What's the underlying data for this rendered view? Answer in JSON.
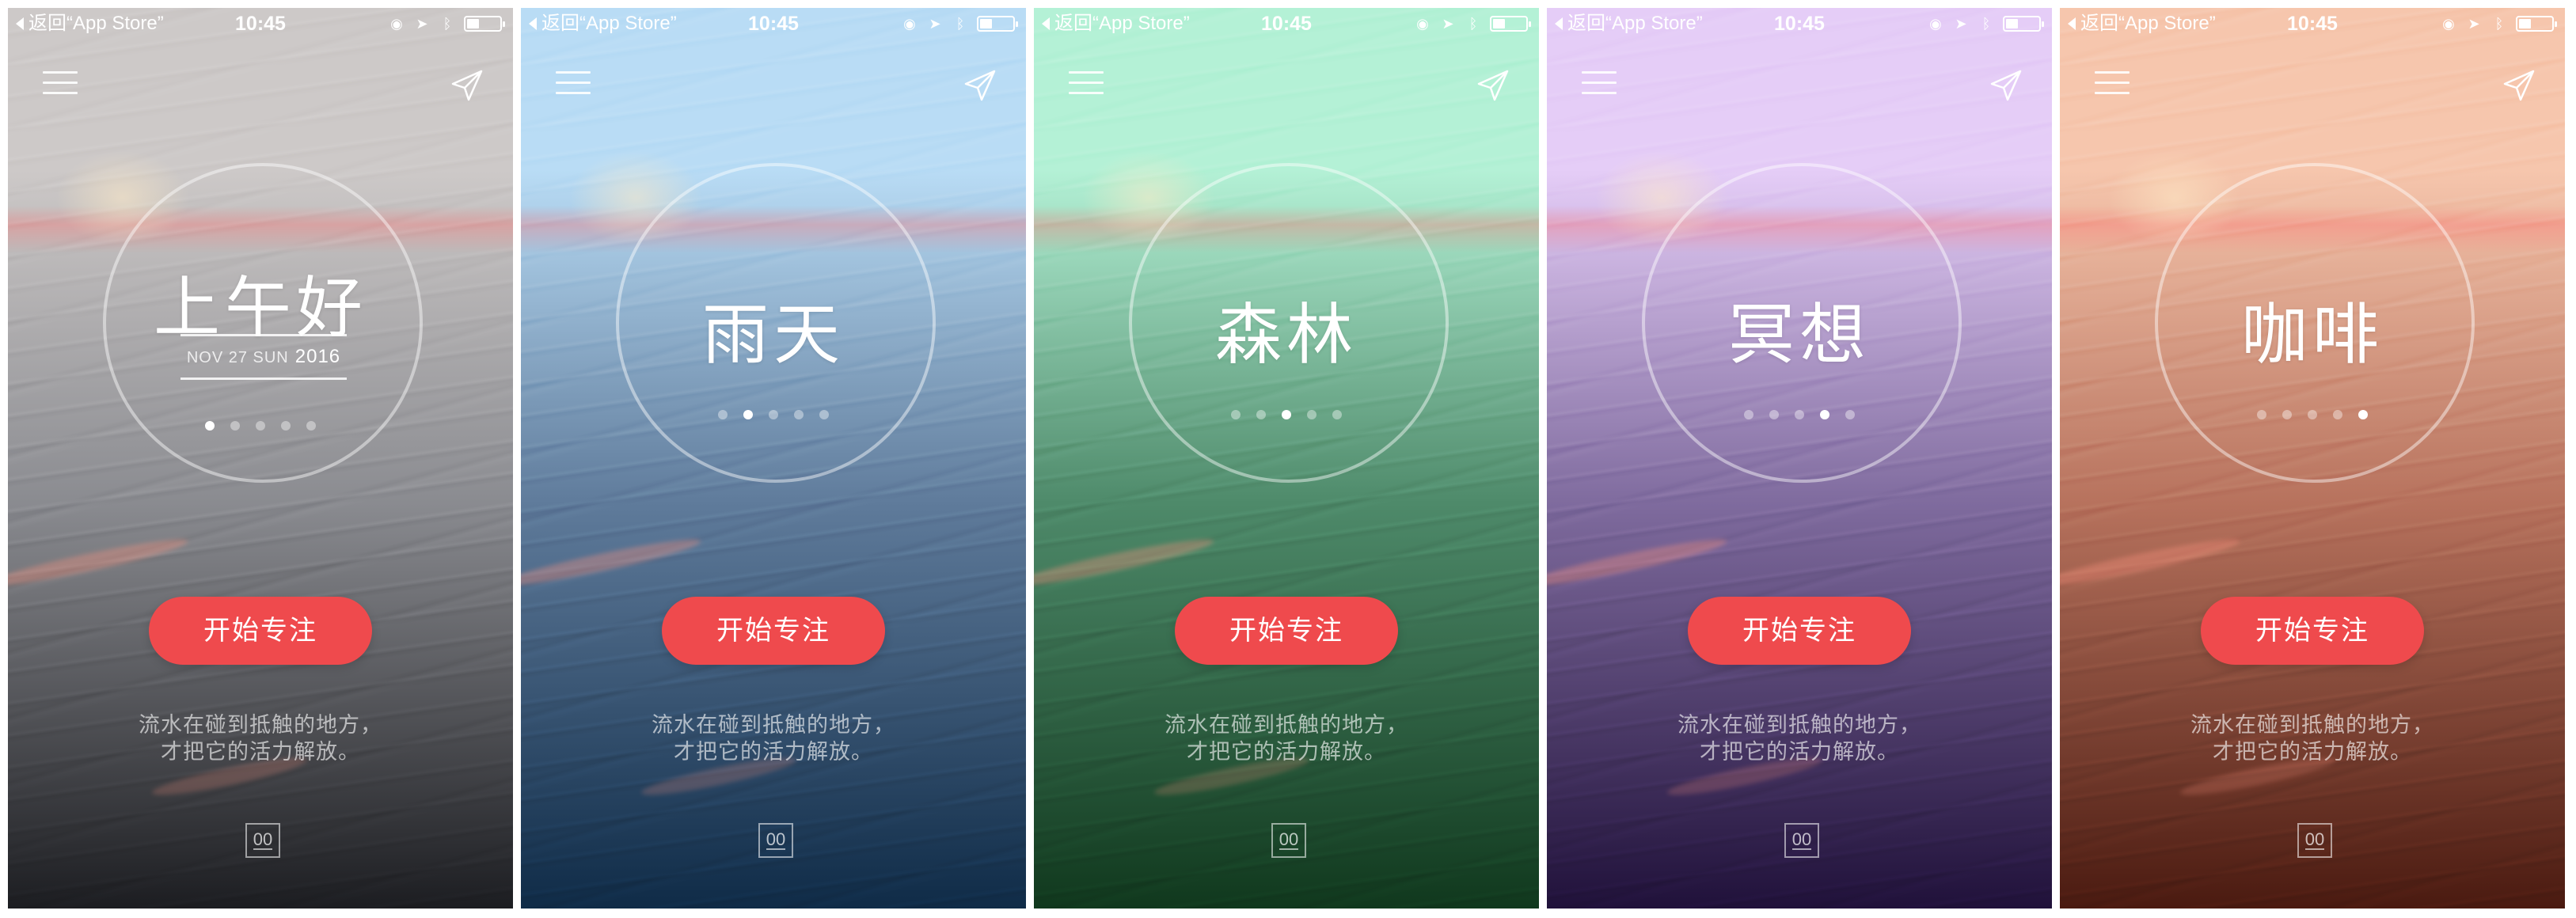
{
  "status_bar": {
    "back_label": "返回“App Store”",
    "time": "10:45",
    "battery_level": 0.35
  },
  "date": {
    "month_day_weekday": "NOV  27  SUN",
    "year": "2016"
  },
  "start_button_label": "开始专注",
  "quote_lines": [
    "流水在碰到抵触的地方，",
    "才把它的活力解放。"
  ],
  "timer_label": "00",
  "screens": [
    {
      "id": "morning",
      "title": "上午好",
      "active_dot": 0,
      "colors": {
        "top": "#cdc9c8",
        "mid": "#8a8b90",
        "bottom": "#1c1d21"
      }
    },
    {
      "id": "rain",
      "title": "雨天",
      "active_dot": 1,
      "colors": {
        "top": "#b9dcf5",
        "mid": "#5f7b9b",
        "bottom": "#0f2b47"
      }
    },
    {
      "id": "forest",
      "title": "森林",
      "active_dot": 2,
      "colors": {
        "top": "#b4f1d6",
        "mid": "#4e8a6a",
        "bottom": "#10381d"
      }
    },
    {
      "id": "meditation",
      "title": "冥想",
      "active_dot": 3,
      "colors": {
        "top": "#e5cdf7",
        "mid": "#7f6b9e",
        "bottom": "#20113a"
      }
    },
    {
      "id": "coffee",
      "title": "咖啡",
      "active_dot": 4,
      "colors": {
        "top": "#f6c6ad",
        "mid": "#b7725d",
        "bottom": "#4a1a10"
      }
    }
  ]
}
